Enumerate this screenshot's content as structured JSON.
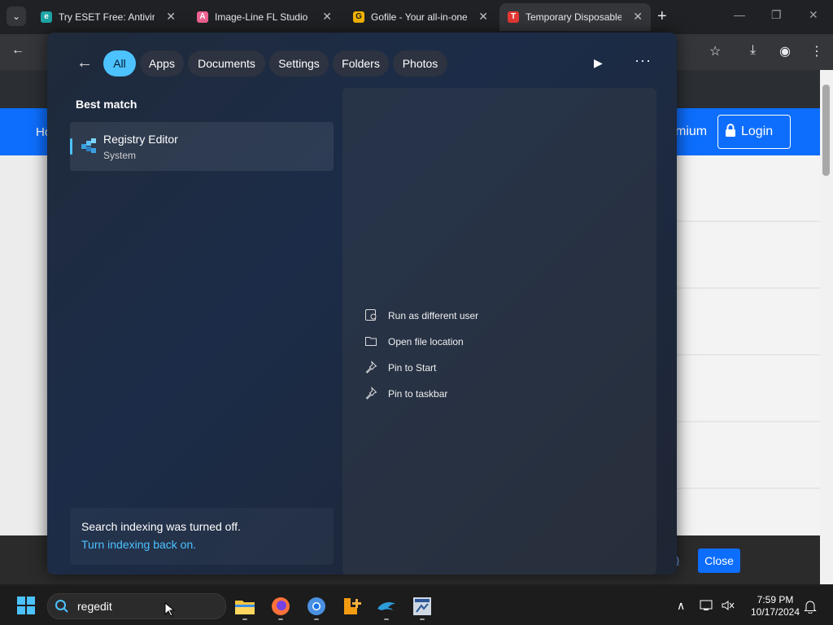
{
  "browser": {
    "tabs": [
      {
        "title": "Try ESET Free: Antivirus",
        "favicon_color": "#1ea5a5",
        "favicon_glyph": "e"
      },
      {
        "title": "Image-Line FL Studio F",
        "favicon_color": "#f06292",
        "favicon_glyph": "A"
      },
      {
        "title": "Gofile - Your all-in-one",
        "favicon_color": "#f4b400",
        "favicon_glyph": "G"
      },
      {
        "title": "Temporary Disposable",
        "favicon_color": "#e53935",
        "favicon_glyph": "T"
      }
    ],
    "new_tab_label": "+",
    "window_controls": {
      "minimize": "—",
      "restore": "❐",
      "close": "✕"
    }
  },
  "webpage": {
    "nav_home_fragment": "Ho",
    "nav_premium_fragment": "mium",
    "login_label": "Login",
    "cookie_link_fragment": "re)",
    "close_label": "Close"
  },
  "search_panel": {
    "filters": [
      "All",
      "Apps",
      "Documents",
      "Settings",
      "Folders",
      "Photos"
    ],
    "selected_filter": "All",
    "best_match_heading": "Best match",
    "result": {
      "name": "Registry Editor",
      "type": "System"
    },
    "index_notice": "Search indexing was turned off.",
    "index_link": "Turn indexing back on.",
    "actions": [
      "Run as different user",
      "Open file location",
      "Pin to Start",
      "Pin to taskbar"
    ]
  },
  "taskbar": {
    "search_value": "regedit",
    "time": "7:59 PM",
    "date": "10/17/2024"
  },
  "colors": {
    "accent": "#4cc2ff",
    "page_nav": "#0d6efd",
    "taskbar": "#1c1c1c"
  }
}
